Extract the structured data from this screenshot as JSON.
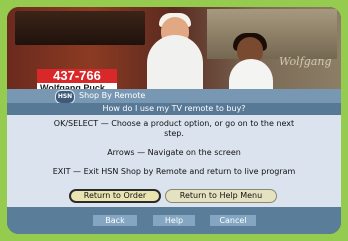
{
  "video": {
    "phone_number": "437-766",
    "host_name": "Wolfgang Puck",
    "watermark": "Wolfgang"
  },
  "panel": {
    "title": "Shop By Remote",
    "badge": "HSN",
    "question": "How do I use my TV remote to buy?",
    "lines": [
      "OK/SELECT — Choose a product option, or go on to the next",
      "step.",
      "Arrows — Navigate on the screen",
      "EXIT — Exit HSN Shop by Remote and return to live program"
    ],
    "buttons": {
      "return_order": "Return to Order",
      "return_help": "Return to Help Menu"
    },
    "footer": {
      "back": "Back",
      "help": "Help",
      "cancel": "Cancel"
    }
  },
  "colors": {
    "frame": "#95cc50",
    "panel": "#5a7d9a",
    "content": "#dbe4ee",
    "phone_banner": "#d8282a"
  }
}
